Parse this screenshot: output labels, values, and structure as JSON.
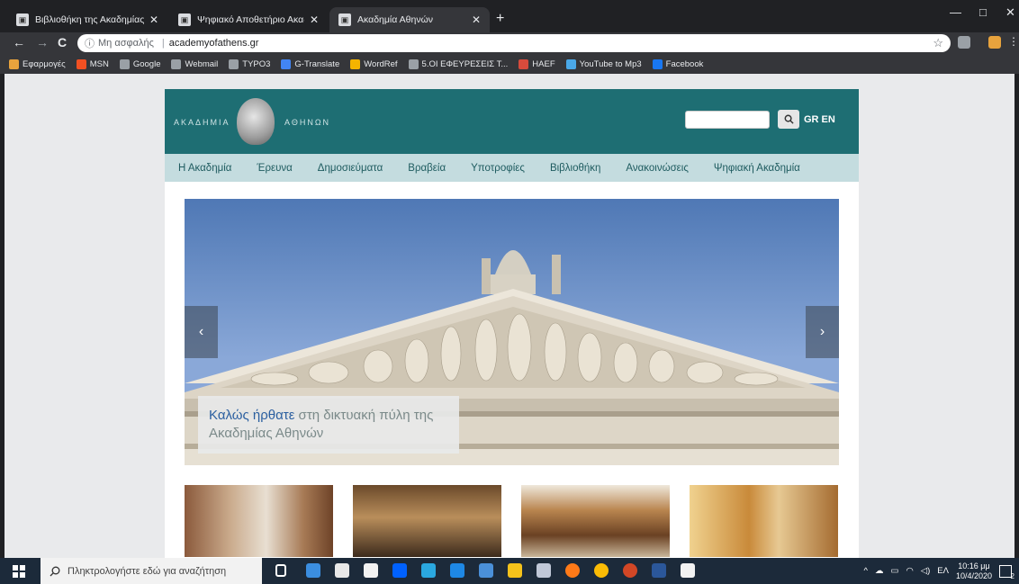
{
  "browser": {
    "tabs": [
      {
        "title": "Βιβλιοθήκη της Ακαδημίας Αθη",
        "active": false
      },
      {
        "title": "Ψηφιακό Αποθετήριο Ακαδημία",
        "active": false
      },
      {
        "title": "Ακαδημία Αθηνών",
        "active": true
      }
    ],
    "new_tab": "+",
    "tab_close": "✕",
    "window_controls": {
      "minimize": "—",
      "maximize": "□",
      "close": "✕"
    },
    "nav": {
      "back": "←",
      "forward": "→",
      "reload": "C"
    },
    "address": {
      "security_label": "Μη ασφαλής",
      "separator": "|",
      "url": "academyofathens.gr"
    },
    "bookmarks": [
      {
        "label": "Εφαρμογές",
        "color": "#e8a33d"
      },
      {
        "label": "MSN",
        "color": "#f25022"
      },
      {
        "label": "Google",
        "color": "#9aa0a6"
      },
      {
        "label": "Webmail",
        "color": "#9aa0a6"
      },
      {
        "label": "TYPO3",
        "color": "#9aa0a6"
      },
      {
        "label": "G-Translate",
        "color": "#4285f4"
      },
      {
        "label": "WordRef",
        "color": "#f4b400"
      },
      {
        "label": "5.ΟΙ ΕΦΕΥΡΕΣΕΙΣ Τ...",
        "color": "#9aa0a6"
      },
      {
        "label": "HAEF",
        "color": "#d84b3c"
      },
      {
        "label": "YouTube to Mp3",
        "color": "#4aa8e8"
      },
      {
        "label": "Facebook",
        "color": "#1877f2"
      }
    ]
  },
  "site": {
    "logo_left": "ΑΚΑΔΗΜΙΑ",
    "logo_right": "ΑΘΗΝΩΝ",
    "lang": "GR EN",
    "search_icon": "magnifier-icon",
    "nav": [
      "Η Ακαδημία",
      "Έρευνα",
      "Δημοσιεύματα",
      "Βραβεία",
      "Υποτροφίες",
      "Βιβλιοθήκη",
      "Ανακοινώσεις",
      "Ψηφιακή Ακαδημία"
    ],
    "hero": {
      "caption_highlight": "Καλώς ήρθατε",
      "caption_rest": " στη δικτυακή πύλη της Ακαδημίας Αθηνών",
      "prev": "‹",
      "next": "›"
    }
  },
  "taskbar": {
    "search_placeholder": "Πληκτρολογήστε εδώ για αναζήτηση",
    "lang": "ΕΛ",
    "time": "10:16 μμ",
    "date": "10/4/2020",
    "notification_count": "2"
  },
  "colors": {
    "header": "#1e6e73",
    "nav_bar": "#c4dcdf",
    "caption_highlight": "#2b5fa0"
  }
}
